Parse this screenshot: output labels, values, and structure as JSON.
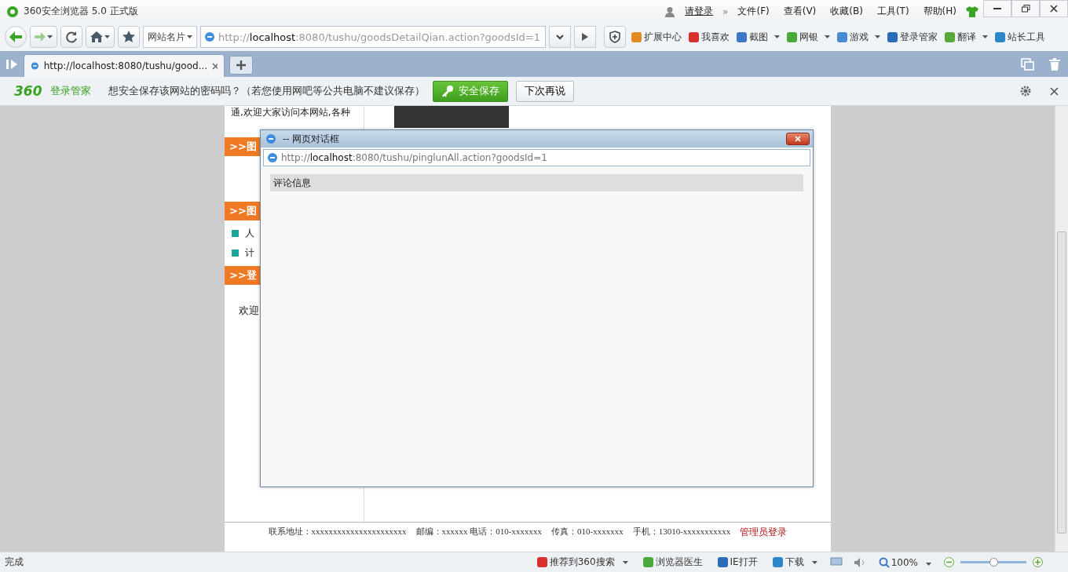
{
  "window": {
    "title": "360安全浏览器 5.0 正式版",
    "login": "请登录",
    "more": "»",
    "menus": [
      "文件(F)",
      "查看(V)",
      "收藏(B)",
      "工具(T)",
      "帮助(H)"
    ]
  },
  "navbar": {
    "site_card": "网站名片",
    "url_scheme": "http://",
    "url_host": "localhost",
    "url_rest": ":8080/tushu/goodsDetailQian.action?goodsId=1",
    "tools": [
      {
        "label": "扩展中心",
        "has_menu": false
      },
      {
        "label": "我喜欢",
        "has_menu": false
      },
      {
        "label": "截图",
        "has_menu": true
      },
      {
        "label": "网银",
        "has_menu": true
      },
      {
        "label": "游戏",
        "has_menu": true
      },
      {
        "label": "登录管家",
        "has_menu": false
      },
      {
        "label": "翻译",
        "has_menu": true
      },
      {
        "label": "站长工具",
        "has_menu": false
      }
    ]
  },
  "tabs": [
    {
      "label": "http://localhost:8080/tushu/good...",
      "selected": true
    }
  ],
  "password_bar": {
    "brand_number": "360",
    "brand_text": "登录管家",
    "message": "想安全保存该网站的密码吗？（若您使用网吧等公共电脑不建议保存）",
    "save": "安全保存",
    "later": "下次再说"
  },
  "page": {
    "intro": "通,欢迎大家访问本网站,各种",
    "sections": [
      {
        "title": ">>图"
      },
      {
        "title": ">>图",
        "items": [
          "人",
          "计"
        ]
      },
      {
        "title": ">>登"
      }
    ],
    "welcome": "欢迎",
    "footer": [
      {
        "kind": "text",
        "text": "联系地址：xxxxxxxxxxxxxxxxxxxxxx"
      },
      {
        "kind": "text",
        "text": "邮编：xxxxxx 电话：010-xxxxxxx"
      },
      {
        "kind": "text",
        "text": "传真：010-xxxxxxx"
      },
      {
        "kind": "text",
        "text": "手机：13010-xxxxxxxxxxx"
      },
      {
        "kind": "link",
        "text": "管理员登录"
      }
    ]
  },
  "dialog": {
    "title": "-- 网页对话框",
    "url_scheme": "http://",
    "url_host": "localhost",
    "url_rest": ":8080/tushu/pinglunAll.action?goodsId=1",
    "heading": "评论信息"
  },
  "status_bar": {
    "status": "完成",
    "items": [
      {
        "label": "推荐到360搜索",
        "has_menu": true
      },
      {
        "label": "浏览器医生",
        "has_menu": false
      },
      {
        "label": "IE打开",
        "has_menu": false
      },
      {
        "label": "下载",
        "has_menu": true
      }
    ],
    "zoom": "100%",
    "zoom_slider": {
      "level": 0.5
    }
  }
}
